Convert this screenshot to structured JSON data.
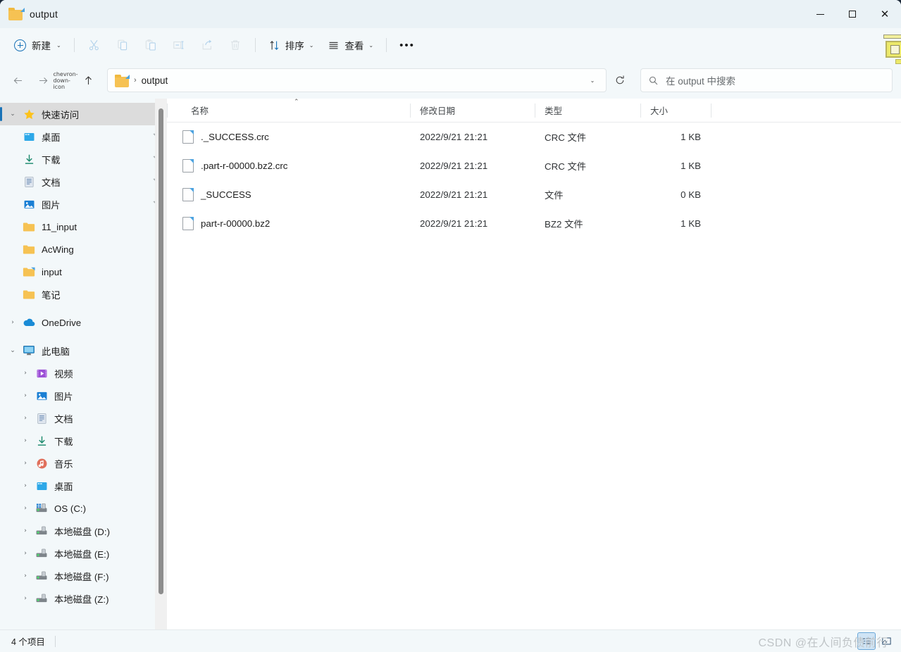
{
  "window": {
    "title": "output",
    "title_icon": "folder-shortcut-icon",
    "controls": {
      "minimize": "—",
      "maximize": "☐",
      "close": "✕"
    }
  },
  "toolbar": {
    "new_label": "新建",
    "new_icon": "plus-circle-icon",
    "cut_icon": "scissors-icon",
    "copy_icon": "copy-icon",
    "paste_icon": "paste-icon",
    "rename_icon": "rename-icon",
    "share_icon": "share-icon",
    "delete_icon": "trash-icon",
    "sort_label": "排序",
    "sort_icon": "sort-arrows-icon",
    "view_label": "查看",
    "view_icon": "lines-icon",
    "more_label": "•••",
    "chevron": "⌄"
  },
  "address": {
    "back_icon": "arrow-left-icon",
    "forward_icon": "arrow-right-icon",
    "recent_icon": "chevron-down-icon",
    "up_icon": "arrow-up-icon",
    "crumb_icon": "folder-shortcut-icon",
    "separator": "›",
    "crumb": "output",
    "dropdown_icon": "chevron-down-icon",
    "refresh_icon": "refresh-icon"
  },
  "search": {
    "icon": "search-icon",
    "placeholder": "在 output 中搜索",
    "value": ""
  },
  "sidebar": {
    "groups": [
      {
        "label": "快速访问",
        "icon": "star-icon",
        "twisty": "⌄",
        "selected": true,
        "items": [
          {
            "label": "桌面",
            "icon": "desktop-icon",
            "pinned": true,
            "twisty": ""
          },
          {
            "label": "下载",
            "icon": "download-icon",
            "pinned": true,
            "twisty": ""
          },
          {
            "label": "文档",
            "icon": "documents-icon",
            "pinned": true,
            "twisty": ""
          },
          {
            "label": "图片",
            "icon": "pictures-icon",
            "pinned": true,
            "twisty": ""
          },
          {
            "label": "11_input",
            "icon": "folder-icon",
            "pinned": false,
            "twisty": ""
          },
          {
            "label": "AcWing",
            "icon": "folder-icon",
            "pinned": false,
            "twisty": ""
          },
          {
            "label": "input",
            "icon": "folder-shortcut-icon",
            "pinned": false,
            "twisty": ""
          },
          {
            "label": "笔记",
            "icon": "folder-icon",
            "pinned": false,
            "twisty": ""
          }
        ]
      },
      {
        "label": "OneDrive",
        "icon": "onedrive-icon",
        "twisty": "›",
        "selected": false,
        "items": []
      },
      {
        "label": "此电脑",
        "icon": "this-pc-icon",
        "twisty": "⌄",
        "selected": false,
        "items": [
          {
            "label": "视频",
            "icon": "videos-icon",
            "pinned": false,
            "twisty": "›"
          },
          {
            "label": "图片",
            "icon": "pictures-icon",
            "pinned": false,
            "twisty": "›"
          },
          {
            "label": "文档",
            "icon": "documents-icon",
            "pinned": false,
            "twisty": "›"
          },
          {
            "label": "下载",
            "icon": "download-icon",
            "pinned": false,
            "twisty": "›"
          },
          {
            "label": "音乐",
            "icon": "music-icon",
            "pinned": false,
            "twisty": "›"
          },
          {
            "label": "桌面",
            "icon": "desktop-icon",
            "pinned": false,
            "twisty": "›"
          },
          {
            "label": "OS (C:)",
            "icon": "os-drive-icon",
            "pinned": false,
            "twisty": "›"
          },
          {
            "label": "本地磁盘 (D:)",
            "icon": "drive-icon",
            "pinned": false,
            "twisty": "›"
          },
          {
            "label": "本地磁盘 (E:)",
            "icon": "drive-icon",
            "pinned": false,
            "twisty": "›"
          },
          {
            "label": "本地磁盘 (F:)",
            "icon": "drive-icon",
            "pinned": false,
            "twisty": "›"
          },
          {
            "label": "本地磁盘 (Z:)",
            "icon": "drive-icon",
            "pinned": false,
            "twisty": "›"
          }
        ]
      }
    ]
  },
  "filelist": {
    "sort_indicator": "⌃",
    "columns": [
      {
        "key": "name",
        "label": "名称"
      },
      {
        "key": "date",
        "label": "修改日期"
      },
      {
        "key": "type",
        "label": "类型"
      },
      {
        "key": "size",
        "label": "大小"
      }
    ],
    "rows": [
      {
        "icon": "file-icon",
        "name": "._SUCCESS.crc",
        "date": "2022/9/21 21:21",
        "type": "CRC 文件",
        "size": "1 KB"
      },
      {
        "icon": "file-icon",
        "name": ".part-r-00000.bz2.crc",
        "date": "2022/9/21 21:21",
        "type": "CRC 文件",
        "size": "1 KB"
      },
      {
        "icon": "file-icon",
        "name": "_SUCCESS",
        "date": "2022/9/21 21:21",
        "type": "文件",
        "size": "0 KB"
      },
      {
        "icon": "file-icon",
        "name": "part-r-00000.bz2",
        "date": "2022/9/21 21:21",
        "type": "BZ2 文件",
        "size": "1 KB"
      }
    ]
  },
  "statusbar": {
    "item_count": "4 个项目",
    "view_details_icon": "details-view-icon",
    "view_large_icon": "large-icons-view-icon",
    "active_view": "details-view-icon"
  },
  "watermark": {
    "text": "CSDN @在人间负债前行"
  },
  "colors": {
    "accent": "#1a73b7",
    "chrome": "#f3f8fa",
    "titlebar": "#eaf2f6",
    "selection": "#dcdcdc",
    "folder": "#f6c253"
  }
}
